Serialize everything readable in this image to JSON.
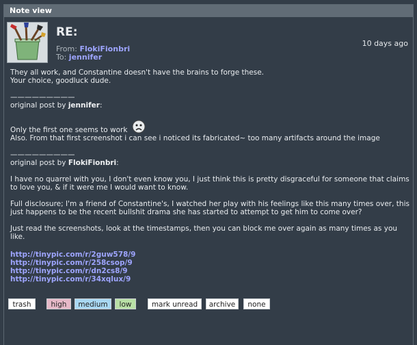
{
  "window": {
    "title": "Note view"
  },
  "note": {
    "subject": "RE:",
    "age": "10 days ago",
    "from_label": "From:",
    "from_user": "FlokiFionbri",
    "to_label": "To:",
    "to_user": "jennifer"
  },
  "message": {
    "line1": "They all work, and Constantine doesn't have the brains to forge these.",
    "line2": "Your choice, goodluck dude.",
    "separator": "—————————",
    "quote1_prefix": "original post by",
    "quote1_user": "jennifer",
    "quote1_suffix": ":",
    "quote1_line1": "Only the first one seems to work",
    "quote1_line2": "Also. From that first screenshot i can see i noticed its fabricated~ too many artifacts around the image",
    "separator2": "—————————",
    "quote2_prefix": "original post by",
    "quote2_user": "FlokiFionbri",
    "quote2_suffix": ":",
    "para1": "I have no quarrel with you, I don't even know you, I just think this is pretty disgraceful for someone that claims to love you, & if it were me I would want to know.",
    "para2": "Full disclosure; I'm a friend of Constantine's, I watched her play with his feelings like this many times over, this just happens to be the recent bullshit drama she has started to attempt to get him to come over?",
    "para3": "Just read the screenshots, look at the timestamps, then you can block me over again as many times as you like."
  },
  "links": [
    "http://tinypic.com/r/2guw578/9",
    "http://tinypic.com/r/258csop/9",
    "http://tinypic.com/r/dn2cs8/9",
    "http://tinypic.com/r/34xqlux/9"
  ],
  "buttons": {
    "trash": "trash",
    "high": "high",
    "medium": "medium",
    "low": "low",
    "mark_unread": "mark unread",
    "archive": "archive",
    "none": "none"
  },
  "colors": {
    "high": "#e6b9c8",
    "medium": "#a9d8f3",
    "low": "#b9e0a6",
    "link": "#9ea5ff"
  },
  "icons": {
    "avatar": "paintbrush-jar-icon",
    "emoticon": "sad-face-icon"
  }
}
